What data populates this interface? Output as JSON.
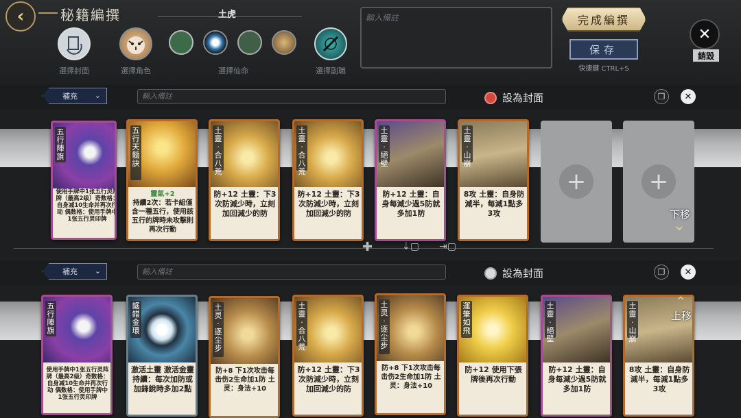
{
  "header": {
    "title": "秘籍編撰",
    "slots": [
      {
        "label": "選擇封面"
      },
      {
        "label": "選擇角色"
      },
      {
        "label": "選擇仙命",
        "name": "土虎"
      },
      {
        "label": "選擇副職"
      }
    ],
    "note_placeholder": "輸入備註",
    "finish_label": "完成編撰",
    "save_label": "保存",
    "shortcut_label": "快捷鍵 CTRL+S",
    "destroy_label": "銷毀"
  },
  "rows": [
    {
      "dropdown": "補充",
      "note_placeholder": "輸入備註",
      "cover_label": "設為封面",
      "cover_selected": true,
      "move_label": "下移",
      "cards": [
        {
          "name": "五行陣旗",
          "desc": "使用手牌中1张五行灵阵牌（最高2级）奇数格：自身减10生命并再次行动 偶数格：使用手牌中1张五行灵印牌",
          "small": true,
          "frame": "purple"
        },
        {
          "name": "五行天髓訣",
          "desc_parts": [
            "靈氣+2",
            "持續2次：若卡組僅含一種五行，使用該五行的牌時未攻擊則再次行動"
          ],
          "frame": "orange"
        },
        {
          "name": "土靈·合八荒",
          "desc": "防+12 土靈：下3次防減少時，立刻加回減少的防",
          "frame": "orange"
        },
        {
          "name": "土靈·合八荒",
          "desc": "防+12 土靈：下3次防減少時，立刻加回減少的防",
          "frame": "orange"
        },
        {
          "name": "土靈·絕壁",
          "desc": "防+12 土靈：自身每減少過5防就多加1防",
          "frame": "purple"
        },
        {
          "name": "土靈·山崩",
          "desc": "8攻 土靈：自身防減半，每減1點多3攻",
          "frame": "orange"
        }
      ]
    },
    {
      "dropdown": "補充",
      "note_placeholder": "輸入備註",
      "cover_label": "設為封面",
      "cover_selected": false,
      "move_label": "上移",
      "cards": [
        {
          "name": "五行陣旗",
          "desc": "使用手牌中1张五行灵阵牌（最高2级）奇数格：自身减10生命并再次行动 偶数格：使用手牌中1张五行灵印牌",
          "small": true,
          "frame": "purple"
        },
        {
          "name": "鋸錯金環",
          "desc": "激活土靈 激活金靈 持續：每次加防或加鋒銳時多加2點",
          "frame": "orange"
        },
        {
          "name": "土灵·逐尘步",
          "desc": "防+8 下1次攻击每击伤2生命加1防 土灵：身法+10",
          "frame": "orange"
        },
        {
          "name": "土靈·合八荒",
          "desc": "防+12 土靈：下3次防減少時，立刻加回減少的防",
          "frame": "orange"
        },
        {
          "name": "土灵·逐尘步",
          "desc": "防+8 下1次攻击每击伤2生命加1防 土灵：身法+10",
          "frame": "orange"
        },
        {
          "name": "運筆如飛",
          "desc": "防+12 使用下張牌後再次行動",
          "frame": "orange"
        },
        {
          "name": "土靈·絕壁",
          "desc": "防+12 土靈：自身每減少過5防就多加1防",
          "frame": "purple"
        },
        {
          "name": "土靈·山崩",
          "desc": "8攻 土靈：自身防減半，每減1點多3攻",
          "frame": "orange"
        }
      ]
    }
  ],
  "colors": {
    "accent_gold": "#b89b5e",
    "save_blue": "#2b3a56",
    "cover_radio_on": "#d34a3a"
  }
}
